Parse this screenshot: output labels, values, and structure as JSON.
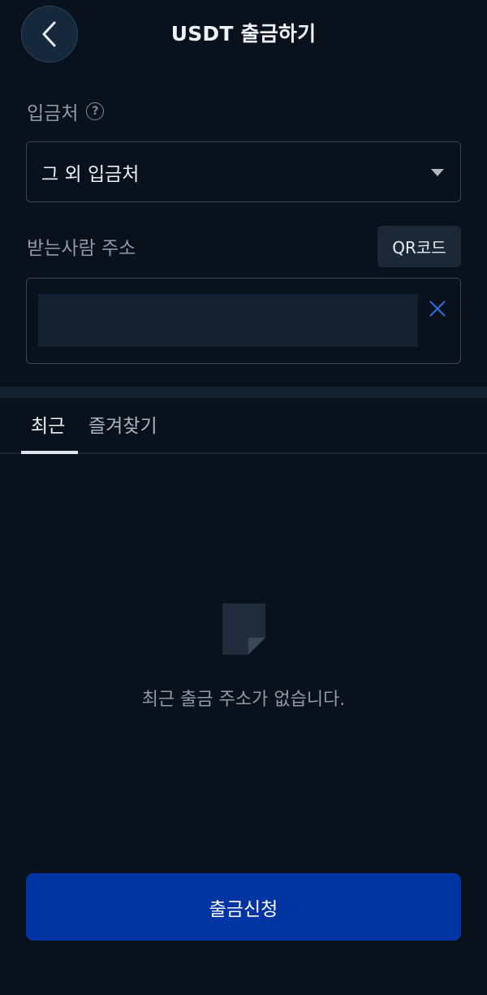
{
  "header": {
    "title": "USDT 출금하기",
    "back_icon": "chevron-left-icon"
  },
  "destination": {
    "label": "입금처",
    "help_icon": "question-circle-icon",
    "help_glyph": "?",
    "selected_value": "그 외 입금처",
    "dropdown_icon": "caret-down-icon"
  },
  "recipient": {
    "label": "받는사람 주소",
    "qr_button_label": "QR코드",
    "address_value": "",
    "clear_icon": "close-icon"
  },
  "tabs": [
    {
      "label": "최근",
      "active": true
    },
    {
      "label": "즐겨찾기",
      "active": false
    }
  ],
  "empty_state": {
    "icon": "document-icon",
    "message": "최근 출금 주소가 없습니다."
  },
  "submit": {
    "label": "출금신청"
  },
  "colors": {
    "background": "#08111c",
    "primary_button": "#0034a3",
    "clear_icon": "#2f6fe0"
  }
}
